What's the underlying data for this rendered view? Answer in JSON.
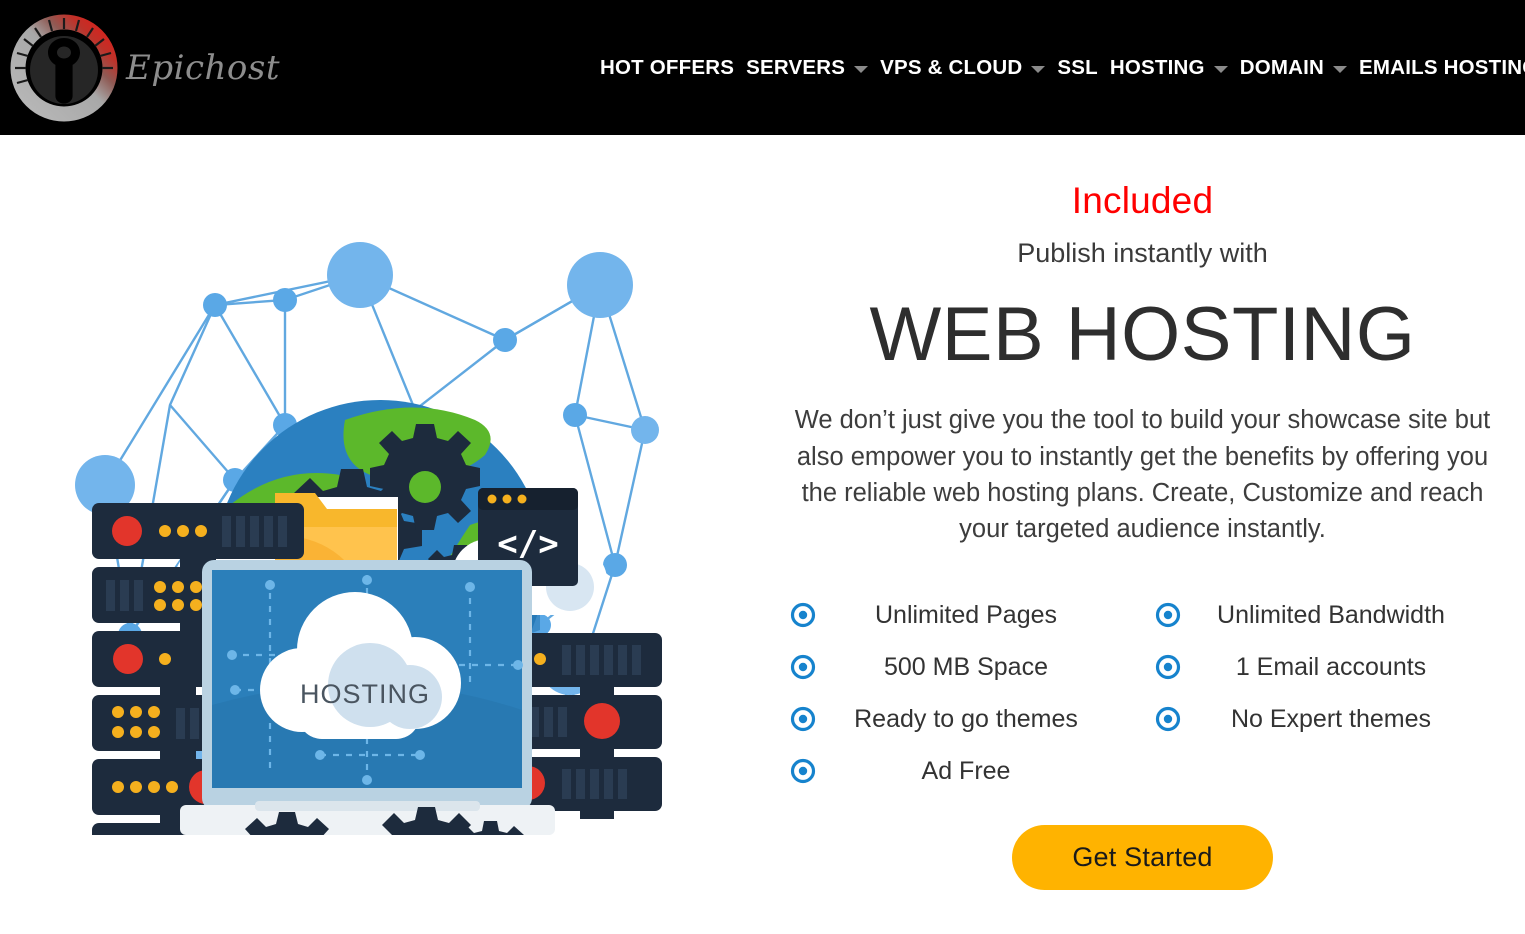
{
  "header": {
    "brand": {
      "name": "Epichost",
      "logo_icon": "gauge-wrench-logo"
    },
    "nav": [
      {
        "label": "HOT OFFERS",
        "has_dropdown": false
      },
      {
        "label": "SERVERS",
        "has_dropdown": true
      },
      {
        "label": "VPS & CLOUD",
        "has_dropdown": true
      },
      {
        "label": "SSL",
        "has_dropdown": false
      },
      {
        "label": "HOSTING",
        "has_dropdown": true
      },
      {
        "label": "DOMAIN",
        "has_dropdown": true
      },
      {
        "label": "EMAILS HOSTING",
        "has_dropdown": true
      }
    ],
    "background_color": "#000000",
    "text_color": "#ffffff"
  },
  "hero": {
    "eyebrow": "Included",
    "eyebrow_color": "#ff0000",
    "subtitle": "Publish instantly with",
    "title": "WEB HOSTING",
    "description": "We don’t just give you the tool to build your showcase site but also empower you to instantly get the benefits by offering you the reliable web hosting plans. Create, Customize and reach your targeted audience instantly."
  },
  "features": {
    "bullet_icon": "radio-dot-icon",
    "bullet_color": "#1683cd",
    "left_column": [
      "Unlimited Pages",
      "500 MB Space",
      "Ready to go themes",
      "Ad Free"
    ],
    "right_column": [
      "Unlimited Bandwidth",
      "1 Email accounts",
      "No Expert themes"
    ]
  },
  "cta": {
    "label": "Get Started",
    "background_color": "#FFB300",
    "text_color": "#1a1a1a"
  },
  "illustration": {
    "name": "web-hosting-network-illustration",
    "screen_label": "HOSTING",
    "code_window_glyph": "</>",
    "colors": {
      "network_node": "#6ab0e8",
      "network_line": "#61a8e0",
      "globe_water": "#2b80c0",
      "globe_land": "#5cb82b",
      "server_body": "#1d2b3d",
      "server_led_red": "#e2352b",
      "server_led_amber": "#f5b01e",
      "laptop_screen": "#2b7fba",
      "folder": "#f8b72c",
      "cloud": "#ffffff"
    }
  }
}
